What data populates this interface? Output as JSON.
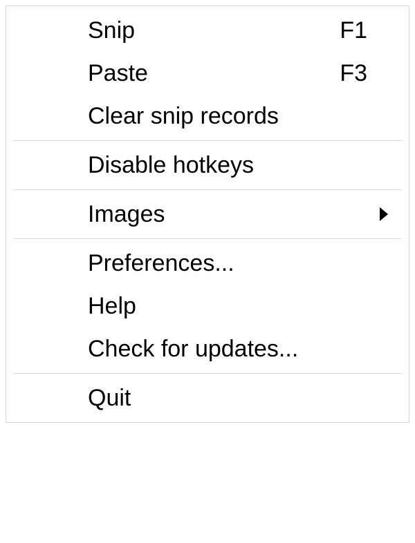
{
  "menu": {
    "items": [
      {
        "label": "Snip",
        "shortcut": "F1",
        "type": "item"
      },
      {
        "label": "Paste",
        "shortcut": "F3",
        "type": "item"
      },
      {
        "label": "Clear snip records",
        "shortcut": "",
        "type": "item"
      },
      {
        "type": "separator"
      },
      {
        "label": "Disable hotkeys",
        "shortcut": "",
        "type": "item"
      },
      {
        "type": "separator"
      },
      {
        "label": "Images",
        "shortcut": "",
        "type": "submenu"
      },
      {
        "type": "separator"
      },
      {
        "label": "Preferences...",
        "shortcut": "",
        "type": "item"
      },
      {
        "label": "Help",
        "shortcut": "",
        "type": "item"
      },
      {
        "label": "Check for updates...",
        "shortcut": "",
        "type": "item"
      },
      {
        "type": "separator"
      },
      {
        "label": "Quit",
        "shortcut": "",
        "type": "item"
      }
    ]
  }
}
